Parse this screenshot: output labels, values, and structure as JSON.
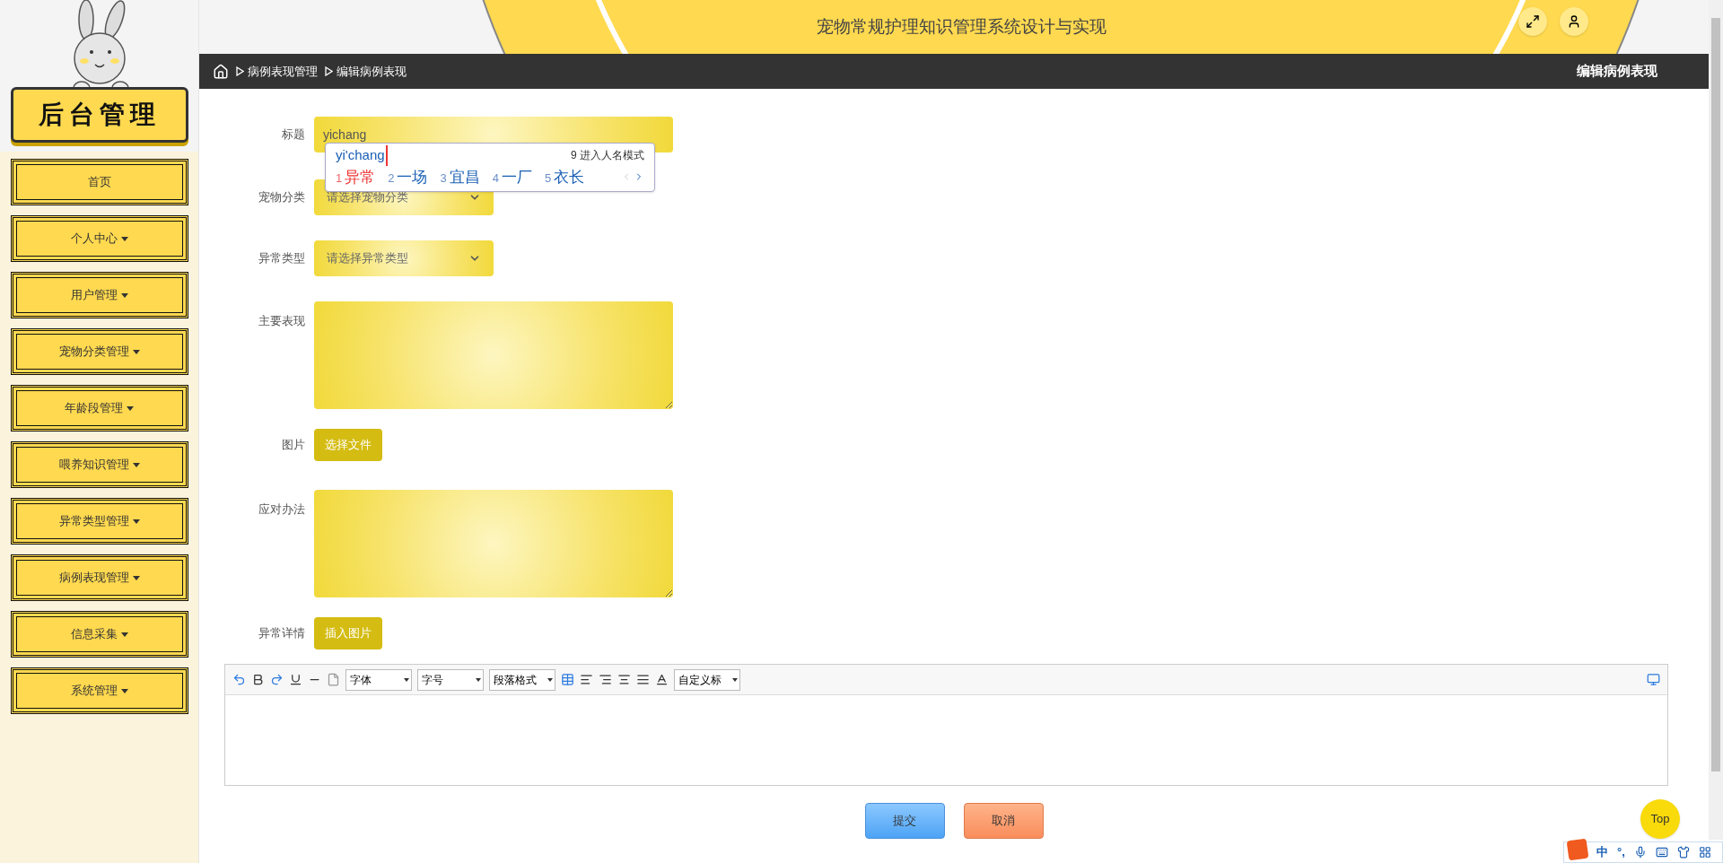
{
  "header": {
    "title": "宠物常规护理知识管理系统设计与实现"
  },
  "breadcrumb": {
    "items": [
      "病例表现管理",
      "编辑病例表现"
    ],
    "page_title": "编辑病例表现"
  },
  "sidebar": {
    "title": "后台管理",
    "items": [
      {
        "label": "首页",
        "has_dropdown": false
      },
      {
        "label": "个人中心",
        "has_dropdown": true
      },
      {
        "label": "用户管理",
        "has_dropdown": true
      },
      {
        "label": "宠物分类管理",
        "has_dropdown": true
      },
      {
        "label": "年龄段管理",
        "has_dropdown": true
      },
      {
        "label": "喂养知识管理",
        "has_dropdown": true
      },
      {
        "label": "异常类型管理",
        "has_dropdown": true
      },
      {
        "label": "病例表现管理",
        "has_dropdown": true
      },
      {
        "label": "信息采集",
        "has_dropdown": true
      },
      {
        "label": "系统管理",
        "has_dropdown": true
      }
    ]
  },
  "form": {
    "fields": [
      {
        "kind": "input",
        "label": "标题",
        "value": "yichang"
      },
      {
        "kind": "select",
        "label": "宠物分类",
        "placeholder": "请选择宠物分类"
      },
      {
        "kind": "select",
        "label": "异常类型",
        "placeholder": "请选择异常类型"
      },
      {
        "kind": "textarea",
        "label": "主要表现"
      },
      {
        "kind": "button",
        "label": "图片",
        "button": "选择文件"
      },
      {
        "kind": "textarea",
        "label": "应对办法"
      },
      {
        "kind": "button",
        "label": "异常详情",
        "button": "插入图片"
      }
    ]
  },
  "editor": {
    "dropdowns": [
      "字体",
      "字号",
      "段落格式",
      "自定义标"
    ]
  },
  "ime": {
    "composition": "yi'chang",
    "hint": "9 进入人名模式",
    "candidates": [
      {
        "index": "1",
        "text": "异常",
        "selected": true
      },
      {
        "index": "2",
        "text": "一场",
        "selected": false
      },
      {
        "index": "3",
        "text": "宜昌",
        "selected": false
      },
      {
        "index": "4",
        "text": "一厂",
        "selected": false
      },
      {
        "index": "5",
        "text": "衣长",
        "selected": false
      }
    ]
  },
  "actions": [
    {
      "kind": "submit",
      "label": "提交"
    },
    {
      "kind": "cancel",
      "label": "取消"
    }
  ],
  "top_button": "Top",
  "ime_toolbar": {
    "mode": "中",
    "punct": "°,"
  }
}
